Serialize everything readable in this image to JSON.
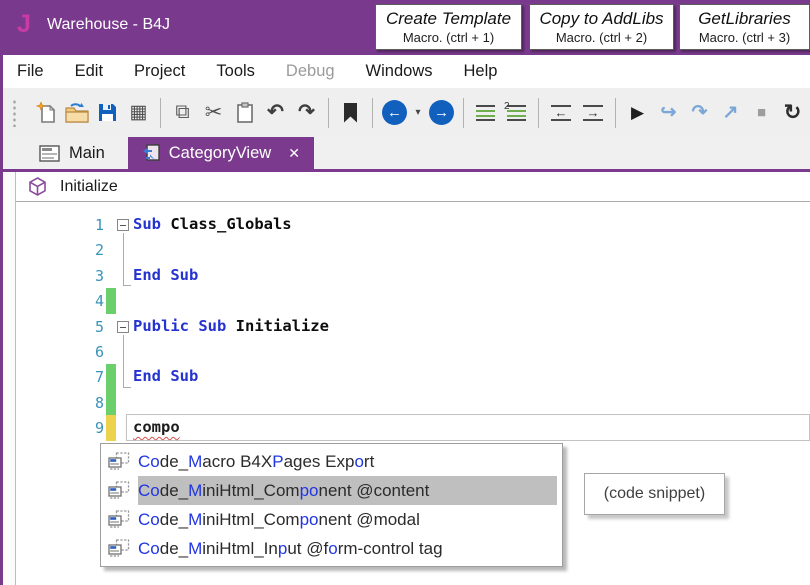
{
  "colors": {
    "titlebar_purple": "#793A8D",
    "active_tab_purple": "#7B3A8E",
    "logo_magenta": "#C83AA4",
    "keyword_blue": "#2533D0",
    "line_number_teal": "#3A93B8",
    "added_line_bar": "#6BCF6B",
    "modified_line_bar": "#EDD24E",
    "selection_gray": "#BFBFBF",
    "match_highlight_blue": "#2135E0",
    "error_squiggle_red": "#D9534F"
  },
  "window": {
    "logo": "J",
    "title": "Warehouse - B4J"
  },
  "macro_buttons": [
    {
      "title": "Create Template",
      "subtitle": "Macro. (ctrl + 1)"
    },
    {
      "title": "Copy to AddLibs",
      "subtitle": "Macro. (ctrl + 2)"
    },
    {
      "title": "GetLibraries",
      "subtitle": "Macro. (ctrl + 3)"
    }
  ],
  "menu": {
    "items": [
      {
        "label": "File"
      },
      {
        "label": "Edit"
      },
      {
        "label": "Project"
      },
      {
        "label": "Tools"
      },
      {
        "label": "Debug",
        "disabled": true
      },
      {
        "label": "Windows"
      },
      {
        "label": "Help"
      }
    ]
  },
  "glyphs": {
    "export": "▦",
    "copy": "⧉",
    "cut": "✂",
    "undo": "↶",
    "redo": "↷",
    "back": "←",
    "forward": "→",
    "caret": "▾",
    "uncomment_badge": "2",
    "outdent_arrow": "←",
    "indent_arrow": "→",
    "run": "▶",
    "step_into": "↪",
    "step_over": "↷",
    "step_out": "↗",
    "stop": "■",
    "restart": "↻",
    "close_tab": "✕"
  },
  "tabs": {
    "items": [
      {
        "label": "Main",
        "active": false
      },
      {
        "label": "CategoryView",
        "active": true
      }
    ]
  },
  "breadcrumb": {
    "label": "Initialize"
  },
  "editor": {
    "current_line": 9,
    "lines": [
      {
        "n": "1",
        "fold": true,
        "bar": null,
        "segments": [
          {
            "text": "Sub ",
            "type": "keyword"
          },
          {
            "text": "Class_Globals",
            "type": "ident"
          }
        ]
      },
      {
        "n": "2",
        "bar": null,
        "segments": []
      },
      {
        "n": "3",
        "bar": null,
        "segments": [
          {
            "text": "End Sub",
            "type": "keyword"
          }
        ]
      },
      {
        "n": "4",
        "bar": "green",
        "segments": []
      },
      {
        "n": "5",
        "fold": true,
        "bar": null,
        "segments": [
          {
            "text": "Public Sub ",
            "type": "keyword"
          },
          {
            "text": "Initialize",
            "type": "ident"
          }
        ]
      },
      {
        "n": "6",
        "bar": null,
        "segments": []
      },
      {
        "n": "7",
        "bar": "green",
        "segments": [
          {
            "text": "End Sub",
            "type": "keyword"
          }
        ]
      },
      {
        "n": "8",
        "bar": "green",
        "segments": []
      },
      {
        "n": "9",
        "bar": "yellow",
        "current": true,
        "segments": [
          {
            "text": "compo",
            "type": "error"
          }
        ]
      }
    ]
  },
  "autocomplete": {
    "items": [
      {
        "selected": false,
        "text": "Code_Macro B4XPages Export",
        "segments": [
          {
            "t": "Co",
            "m": true
          },
          {
            "t": "de_",
            "m": false
          },
          {
            "t": "M",
            "m": true
          },
          {
            "t": "acro B4X",
            "m": false
          },
          {
            "t": "P",
            "m": true
          },
          {
            "t": "ages Exp",
            "m": false
          },
          {
            "t": "o",
            "m": true
          },
          {
            "t": "rt",
            "m": false
          }
        ]
      },
      {
        "selected": true,
        "text": "Code_MiniHtml_Component @content",
        "segments": [
          {
            "t": "Co",
            "m": true
          },
          {
            "t": "de_",
            "m": false
          },
          {
            "t": "M",
            "m": true
          },
          {
            "t": "iniHtml_Com",
            "m": false
          },
          {
            "t": "po",
            "m": true
          },
          {
            "t": "nent @content",
            "m": false
          },
          {
            "t": "",
            "m": false
          },
          {
            "t": "",
            "m": false
          }
        ]
      },
      {
        "selected": false,
        "text": "Code_MiniHtml_Component @modal",
        "segments": [
          {
            "t": "Co",
            "m": true
          },
          {
            "t": "de_",
            "m": false
          },
          {
            "t": "M",
            "m": true
          },
          {
            "t": "iniHtml_Com",
            "m": false
          },
          {
            "t": "po",
            "m": true
          },
          {
            "t": "nent @modal",
            "m": false
          },
          {
            "t": "",
            "m": false
          },
          {
            "t": "",
            "m": false
          }
        ]
      },
      {
        "selected": false,
        "text": "Code_MiniHtml_Input @form-control tag",
        "segments": [
          {
            "t": "Co",
            "m": true
          },
          {
            "t": "de_",
            "m": false
          },
          {
            "t": "M",
            "m": true
          },
          {
            "t": "iniHtml_In",
            "m": false
          },
          {
            "t": "p",
            "m": true
          },
          {
            "t": "ut @f",
            "m": false
          },
          {
            "t": "o",
            "m": true
          },
          {
            "t": "rm-control tag",
            "m": false
          }
        ]
      }
    ]
  },
  "tooltip": {
    "text": "(code snippet)"
  }
}
